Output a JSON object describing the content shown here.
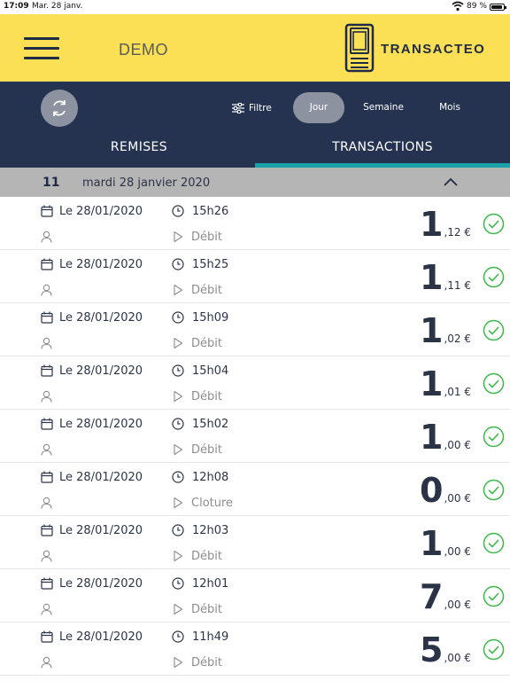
{
  "status_bar": {
    "time": "17:09",
    "date": "Mar. 28 janv.",
    "battery": "89 %"
  },
  "header": {
    "title": "DEMO",
    "logo_text": "TRANSACTEO",
    "background": "#fbdf54"
  },
  "toolbar": {
    "filter_label": "Filtre",
    "periods": [
      "Jour",
      "Semaine",
      "Mois"
    ],
    "active_period": "Jour",
    "background": "#253350"
  },
  "tabs": {
    "items": [
      "REMISES",
      "TRANSACTIONS"
    ],
    "active": "TRANSACTIONS",
    "accent": "#1aa2a8"
  },
  "day_group": {
    "count": "11",
    "label": "mardi 28 janvier 2020",
    "expanded": true
  },
  "transactions": [
    {
      "date": "Le 28/01/2020",
      "time": "15h26",
      "type": "Débit",
      "amount_int": "1",
      "amount_dec": ",12 €",
      "status": "success"
    },
    {
      "date": "Le 28/01/2020",
      "time": "15h25",
      "type": "Débit",
      "amount_int": "1",
      "amount_dec": ",11 €",
      "status": "success"
    },
    {
      "date": "Le 28/01/2020",
      "time": "15h09",
      "type": "Débit",
      "amount_int": "1",
      "amount_dec": ",02 €",
      "status": "success"
    },
    {
      "date": "Le 28/01/2020",
      "time": "15h04",
      "type": "Débit",
      "amount_int": "1",
      "amount_dec": ",01 €",
      "status": "success"
    },
    {
      "date": "Le 28/01/2020",
      "time": "15h02",
      "type": "Débit",
      "amount_int": "1",
      "amount_dec": ",00 €",
      "status": "success"
    },
    {
      "date": "Le 28/01/2020",
      "time": "12h08",
      "type": "Cloture",
      "amount_int": "0",
      "amount_dec": ",00 €",
      "status": "success"
    },
    {
      "date": "Le 28/01/2020",
      "time": "12h03",
      "type": "Débit",
      "amount_int": "1",
      "amount_dec": ",00 €",
      "status": "success"
    },
    {
      "date": "Le 28/01/2020",
      "time": "12h01",
      "type": "Débit",
      "amount_int": "7",
      "amount_dec": ",00 €",
      "status": "success"
    },
    {
      "date": "Le 28/01/2020",
      "time": "11h49",
      "type": "Débit",
      "amount_int": "5",
      "amount_dec": ",00 €",
      "status": "success"
    }
  ],
  "icons": {
    "row_date": "calendar-icon",
    "row_time": "clock-icon",
    "row_user": "user-icon",
    "row_type": "play-icon",
    "row_status": "check-circle-icon",
    "success_color": "#3cb64a"
  }
}
